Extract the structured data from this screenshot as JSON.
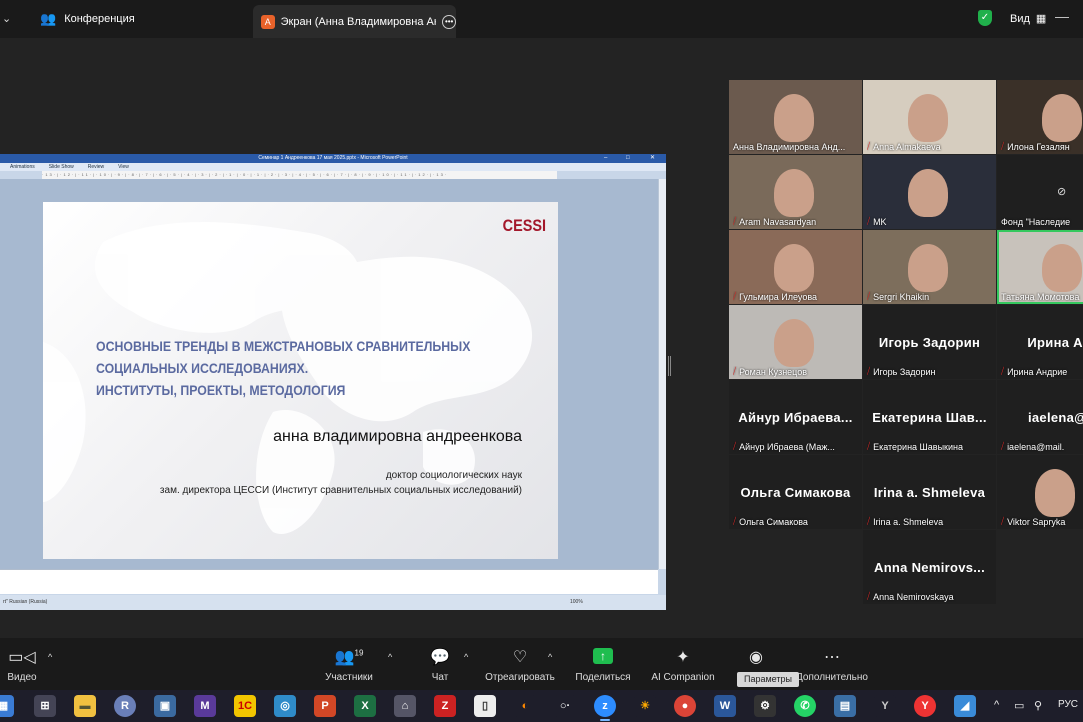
{
  "topbar": {
    "chevron": "⌄",
    "meeting_label": "Конференция",
    "tab_badge": "А",
    "tab_label": "Экран (Анна Владимировна Ан,",
    "view_label": "Вид"
  },
  "ppt": {
    "window_title": "Семинар 1 Андреенкова 17 мая 2025.pptx - Microsoft PowerPoint",
    "menu": [
      "Animations",
      "Slide Show",
      "Review",
      "View"
    ],
    "ruler": "·13·|·12·|·11·|·10·|·9·|·8·|·7·|·6·|·5·|·4·|·3·|·2·|·1·|·0·|·1·|·2·|·3·|·4·|·5·|·6·|·7·|·8·|·9·|·10·|·11·|·12·|·13·",
    "status_left": "rt\"   Russian (Russia)",
    "zoom": "100%",
    "slide": {
      "logo": "CESSI",
      "title_lines": [
        "ОСНОВНЫЕ ТРЕНДЫ В МЕЖСТРАНОВЫХ СРАВНИТЕЛЬНЫХ",
        "СОЦИАЛЬНЫХ ИССЛЕДОВАНИЯХ.",
        "ИНСТИТУТЫ, ПРОЕКТЫ, МЕТОДОЛОГИЯ"
      ],
      "author": "анна владимировна андреенкова",
      "degree": "доктор социологических наук",
      "position": "зам. директора ЦЕССИ (Институт сравнительных социальных исследований)"
    }
  },
  "participants": [
    {
      "name": "Анна Владимировна Анд...",
      "muted": false,
      "video": true,
      "big": ""
    },
    {
      "name": "Anna Almakaeva",
      "muted": true,
      "video": true,
      "big": ""
    },
    {
      "name": "Илона Гезалян",
      "muted": true,
      "video": true,
      "big": ""
    },
    {
      "name": "Aram Navasardyan",
      "muted": true,
      "video": true,
      "big": ""
    },
    {
      "name": "MK",
      "muted": true,
      "video": true,
      "big": ""
    },
    {
      "name": "Фонд \"Наследие",
      "muted": false,
      "video": false,
      "big": ""
    },
    {
      "name": "Гульмира Илеуова",
      "muted": true,
      "video": true,
      "big": ""
    },
    {
      "name": "Sergri Khaikin",
      "muted": true,
      "video": true,
      "big": ""
    },
    {
      "name": "Татьяна Момотова",
      "muted": false,
      "video": true,
      "big": ""
    },
    {
      "name": "Роман Кузнецов",
      "muted": true,
      "video": true,
      "big": ""
    },
    {
      "name": "Игорь Задорин",
      "muted": true,
      "video": false,
      "big": "Игорь Задорин"
    },
    {
      "name": "Ирина Андрие",
      "muted": true,
      "video": false,
      "big": "Ирина Анд"
    },
    {
      "name": "Айнур Ибраева (Маж...",
      "muted": true,
      "video": false,
      "big": "Айнур Ибраева..."
    },
    {
      "name": "Екатерина Шавыкина",
      "muted": true,
      "video": false,
      "big": "Екатерина Шав..."
    },
    {
      "name": "iaelena@mail.",
      "muted": true,
      "video": false,
      "big": "iaelena@m"
    },
    {
      "name": "Ольга Симакова",
      "muted": true,
      "video": false,
      "big": "Ольга Симакова"
    },
    {
      "name": "Irina a. Shmeleva",
      "muted": true,
      "video": false,
      "big": "Irina a. Shmeleva"
    },
    {
      "name": "Viktor Saprykа",
      "muted": true,
      "video": true,
      "big": ""
    },
    {
      "name": "Anna Nemirovskaya",
      "muted": true,
      "video": false,
      "big": "Anna Nemirovs..."
    }
  ],
  "toolbar": {
    "video": "Видео",
    "participants": "Участники",
    "participants_count": "19",
    "chat": "Чат",
    "react": "Отреагировать",
    "share": "Поделиться",
    "ai": "AI Companion",
    "record": "Параметры",
    "more": "Дополнительно",
    "tooltip": "Параметры"
  },
  "taskbar": {
    "lang": "РУС"
  },
  "colors": {
    "active_speaker": "#35c85e",
    "muted": "#e02828",
    "share_green": "#1fbd4f"
  }
}
